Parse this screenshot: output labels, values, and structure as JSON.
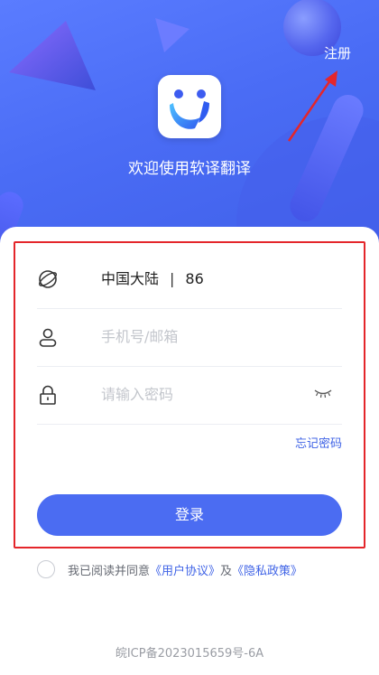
{
  "header": {
    "register_label": "注册",
    "welcome_text": "欢迎使用软译翻译"
  },
  "form": {
    "region_name": "中国大陆",
    "region_separator": "|",
    "region_code": "86",
    "phone_placeholder": "手机号/邮箱",
    "password_placeholder": "请输入密码",
    "forgot_label": "忘记密码",
    "login_label": "登录"
  },
  "agreement": {
    "prefix": "我已阅读并同意",
    "user_agreement": "《用户协议》",
    "and": "及",
    "privacy_policy": "《隐私政策》"
  },
  "footer": {
    "icp": "皖ICP备2023015659号-6A"
  },
  "icons": {
    "region": "globe-icon",
    "phone": "user-icon",
    "password": "lock-icon",
    "visibility": "eye-closed-icon",
    "logo": "app-logo-icon"
  },
  "colors": {
    "primary": "#4b6cf2",
    "link": "#3f63e6",
    "highlight_border": "#e4262b"
  }
}
